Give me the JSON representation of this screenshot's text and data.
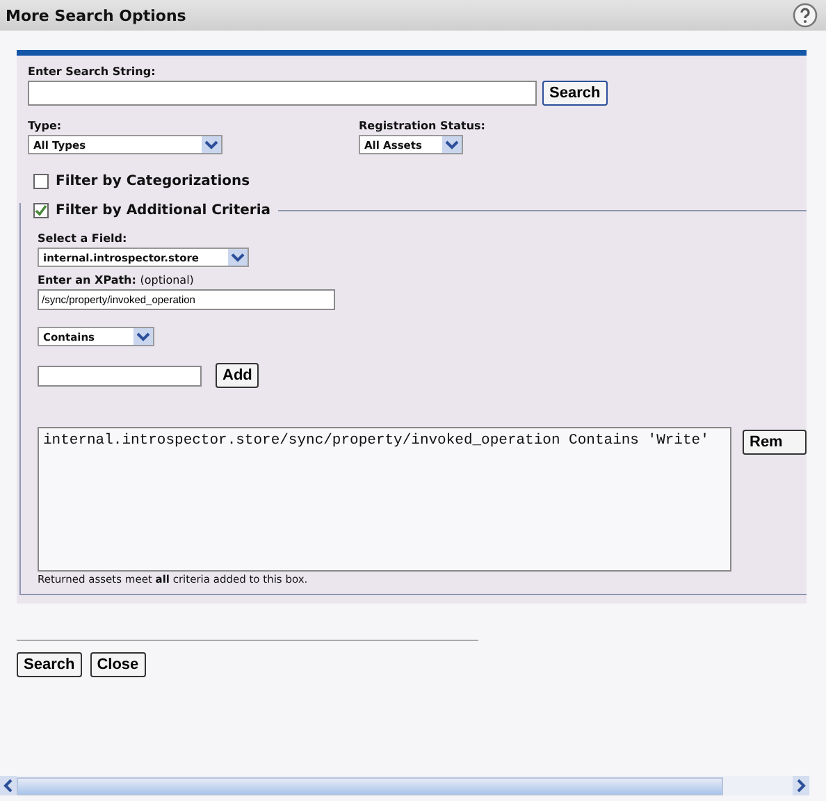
{
  "window": {
    "title": "More Search Options"
  },
  "search": {
    "label": "Enter Search String:",
    "button": "Search"
  },
  "type": {
    "label": "Type:",
    "value": "All Types"
  },
  "registration": {
    "label": "Registration Status:",
    "value": "All Assets"
  },
  "filters": [
    {
      "label": "Filter by Categorizations",
      "checked": false
    },
    {
      "label": "Filter by Additional Criteria",
      "checked": true
    }
  ],
  "criteria": {
    "field_label": "Select a Field:",
    "field_value": "internal.introspector.store",
    "xpath_label": "Enter an XPath:",
    "xpath_hint": "(optional)",
    "xpath_value": "/sync/property/invoked_operation",
    "operator": "Contains",
    "add_button": "Add",
    "entries": [
      "internal.introspector.store/sync/property/invoked_operation Contains 'Write'"
    ],
    "remove_button": "Rem",
    "note": "Returned assets meet **all** criteria added to this box."
  },
  "buttons": [
    "Search",
    "Close"
  ]
}
